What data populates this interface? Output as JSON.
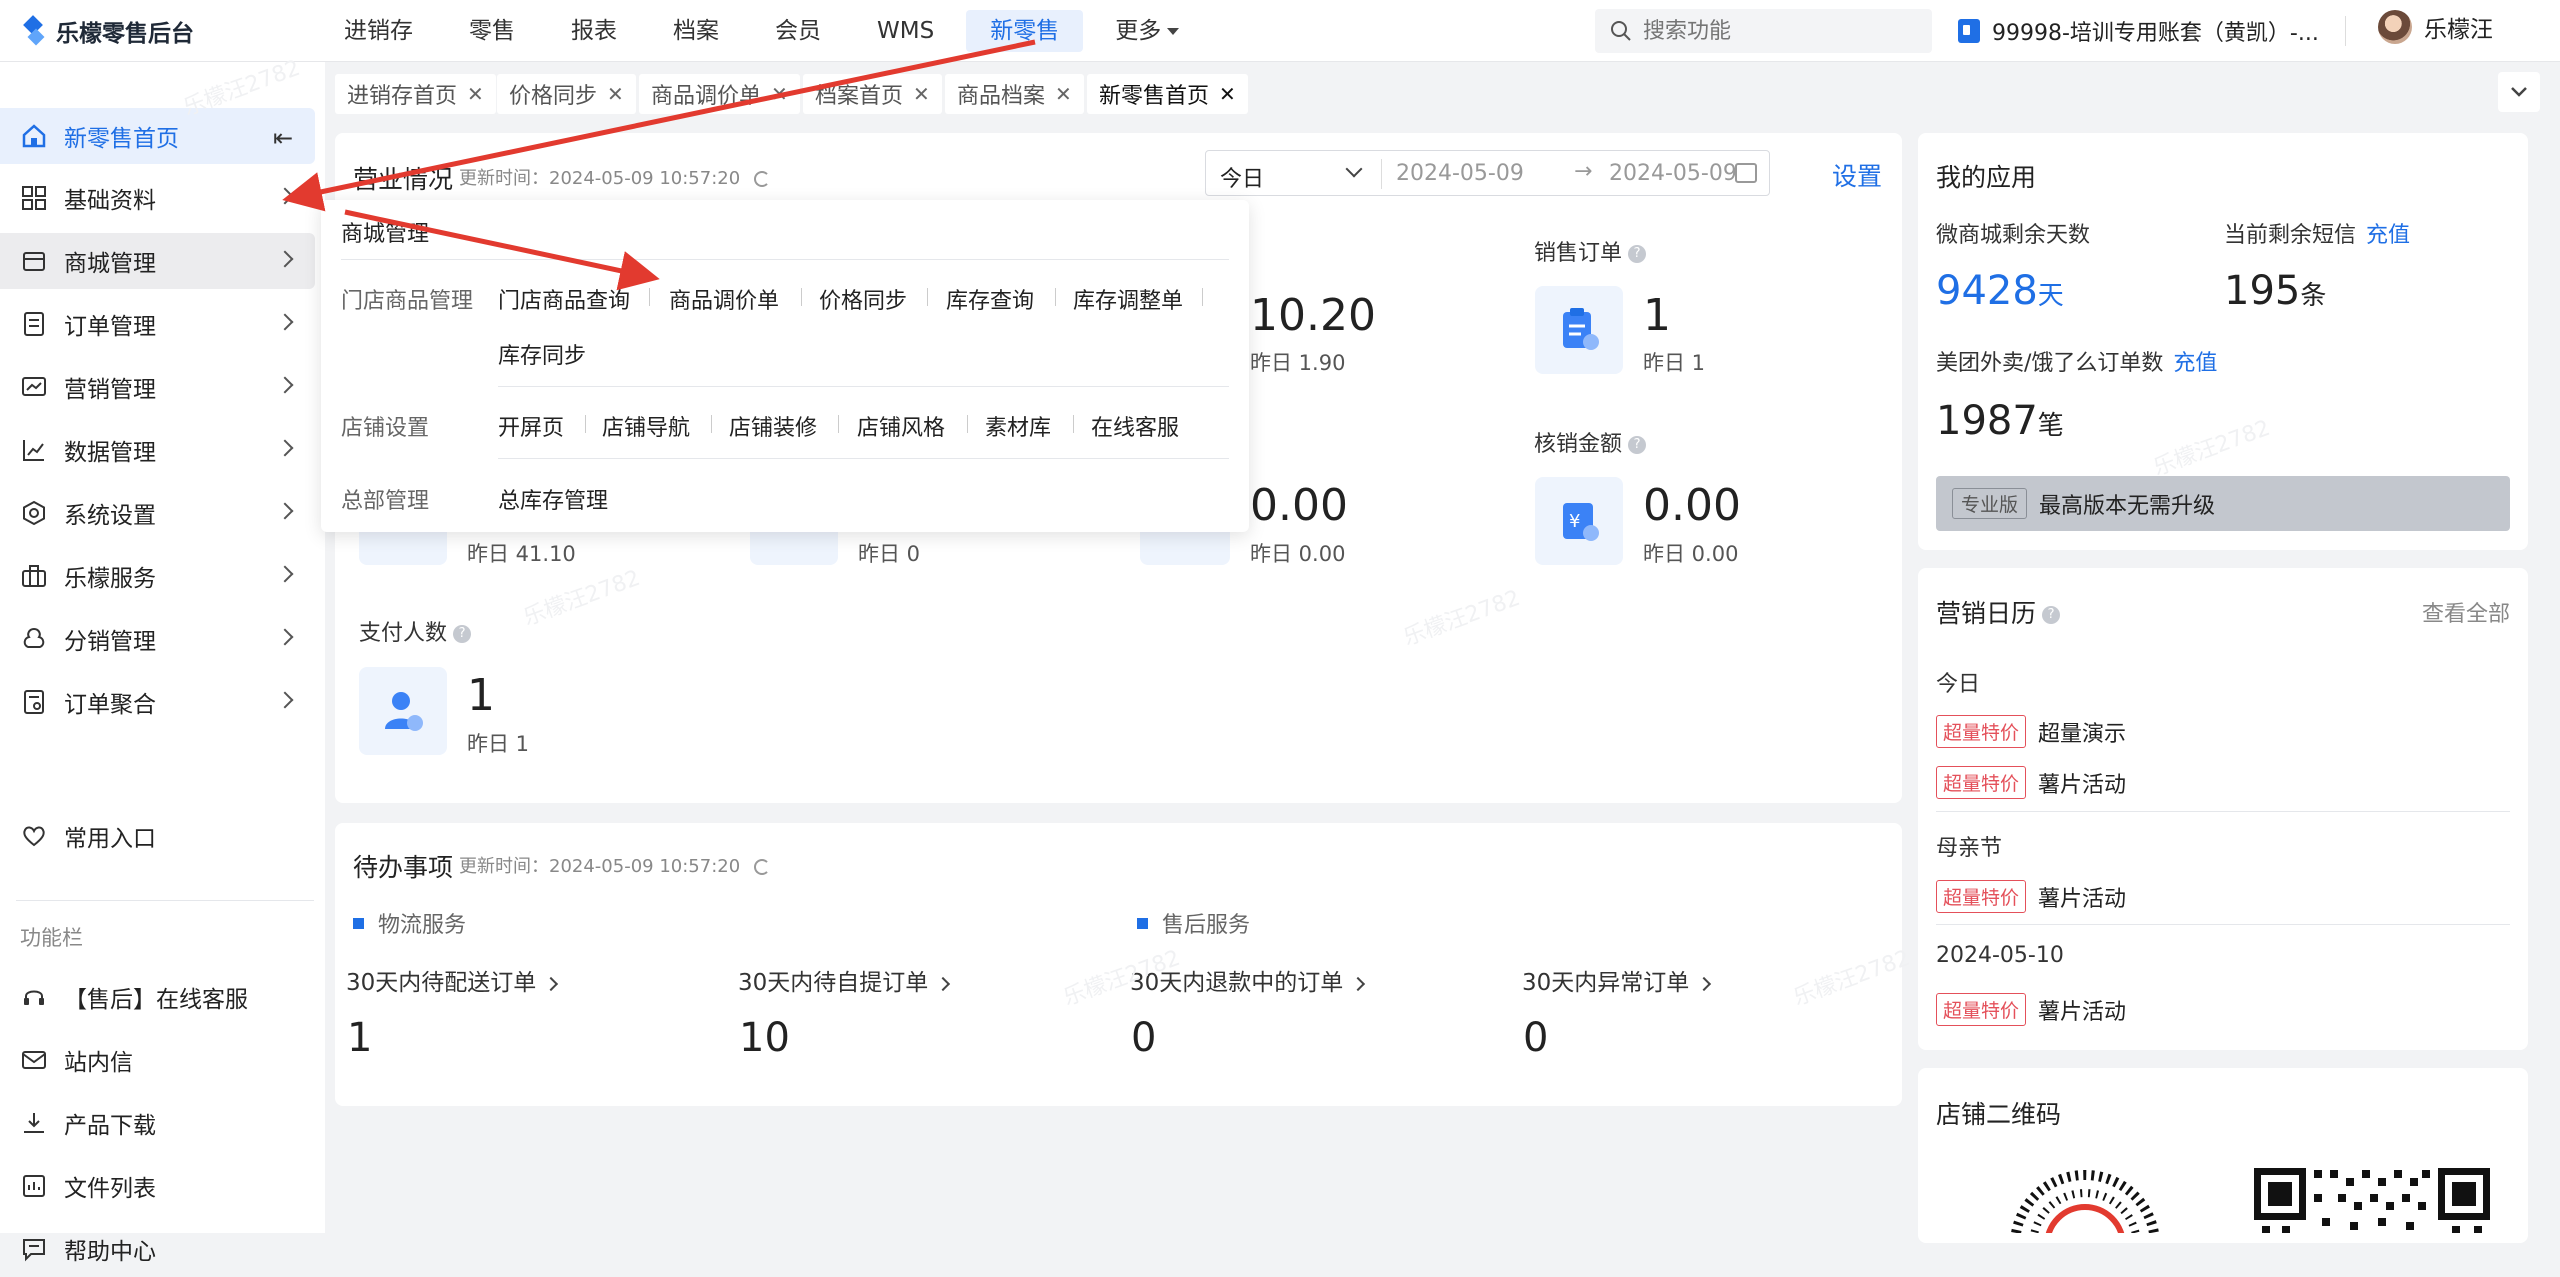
{
  "app": {
    "name": "乐檬零售后台"
  },
  "nav": {
    "items": [
      "进销存",
      "零售",
      "报表",
      "档案",
      "会员",
      "WMS",
      "新零售",
      "更多"
    ],
    "active_index": 6
  },
  "search": {
    "placeholder": "搜索功能"
  },
  "account": {
    "name": "99998-培训专用账套（黄凯）-..."
  },
  "user": {
    "name": "乐檬汪"
  },
  "sidebar": {
    "items": [
      {
        "label": "新零售首页",
        "icon": "home-icon"
      },
      {
        "label": "基础资料",
        "icon": "grid-icon"
      },
      {
        "label": "商城管理",
        "icon": "shop-icon"
      },
      {
        "label": "订单管理",
        "icon": "order-icon"
      },
      {
        "label": "营销管理",
        "icon": "chart-icon"
      },
      {
        "label": "数据管理",
        "icon": "line-chart-icon"
      },
      {
        "label": "系统设置",
        "icon": "settings-icon"
      },
      {
        "label": "乐檬服务",
        "icon": "briefcase-icon"
      },
      {
        "label": "分销管理",
        "icon": "distribution-icon"
      },
      {
        "label": "订单聚合",
        "icon": "aggregate-icon"
      }
    ],
    "favorites": "常用入口",
    "toolbar_caption": "功能栏",
    "tools": [
      {
        "label": "【售后】在线客服",
        "icon": "headset-icon"
      },
      {
        "label": "站内信",
        "icon": "mail-icon"
      },
      {
        "label": "产品下载",
        "icon": "download-icon"
      },
      {
        "label": "文件列表",
        "icon": "file-list-icon"
      },
      {
        "label": "帮助中心",
        "icon": "help-chat-icon"
      }
    ]
  },
  "tabs": [
    "进销存首页",
    "价格同步",
    "商品调价单",
    "档案首页",
    "商品档案",
    "新零售首页"
  ],
  "business": {
    "title": "营业情况",
    "update_time": "更新时间：2024-05-09 10:57:20",
    "date_range": {
      "preset": "今日",
      "start": "2024-05-09",
      "end": "2024-05-09",
      "arrow": "→"
    },
    "settings": "设置",
    "metrics": [
      {
        "label": "销售订单",
        "value": "1",
        "prev": "昨日 1"
      },
      {
        "label": "核销金额",
        "value": "0.00",
        "prev": "昨日 0.00"
      },
      {
        "label": "支付人数",
        "value": "1",
        "prev": "昨日 1"
      }
    ],
    "partial": [
      {
        "value": "10.20",
        "prev": "昨日 1.90"
      },
      {
        "value": "0.00",
        "prev": "昨日 0.00"
      },
      {
        "prev": "昨日 41.10"
      },
      {
        "prev": "昨日 0"
      }
    ]
  },
  "dropdown": {
    "title": "商城管理",
    "groups": [
      {
        "name": "门店商品管理",
        "links": [
          "门店商品查询",
          "商品调价单",
          "价格同步",
          "库存查询",
          "库存调整单",
          "库存同步"
        ]
      },
      {
        "name": "店铺设置",
        "links": [
          "开屏页",
          "店铺导航",
          "店铺装修",
          "店铺风格",
          "素材库",
          "在线客服"
        ]
      },
      {
        "name": "总部管理",
        "links": [
          "总库存管理"
        ]
      }
    ]
  },
  "todo": {
    "title": "待办事项",
    "update_time": "更新时间：2024-05-09 10:57:20",
    "sections": [
      "物流服务",
      "售后服务"
    ],
    "items": [
      {
        "label": "30天内待配送订单",
        "value": "1"
      },
      {
        "label": "30天内待自提订单",
        "value": "10"
      },
      {
        "label": "30天内退款中的订单",
        "value": "0"
      },
      {
        "label": "30天内异常订单",
        "value": "0"
      }
    ]
  },
  "apps": {
    "title": "我的应用",
    "mall_days_label": "微商城剩余天数",
    "mall_days": "9428",
    "mall_days_unit": "天",
    "sms_label": "当前剩余短信",
    "sms": "195",
    "sms_unit": "条",
    "recharge": "充值",
    "delivery_label": "美团外卖/饿了么订单数",
    "delivery": "1987",
    "delivery_unit": "笔",
    "edition_tag": "专业版",
    "edition_text": "最高版本无需升级"
  },
  "calendar": {
    "title": "营销日历",
    "view_all": "查看全部",
    "days": [
      {
        "date": "今日",
        "events": [
          {
            "tag": "超量特价",
            "name": "超量演示"
          },
          {
            "tag": "超量特价",
            "name": "薯片活动"
          }
        ]
      },
      {
        "date": "母亲节",
        "events": [
          {
            "tag": "超量特价",
            "name": "薯片活动"
          }
        ]
      },
      {
        "date": "2024-05-10",
        "events": [
          {
            "tag": "超量特价",
            "name": "薯片活动"
          }
        ]
      }
    ]
  },
  "store_qr": {
    "title": "店铺二维码"
  },
  "watermark": "乐檬汪2782",
  "colors": {
    "accent": "#1f6fe5",
    "tag_red": "#e4505a",
    "annotation_arrow": "#e23a2f"
  }
}
